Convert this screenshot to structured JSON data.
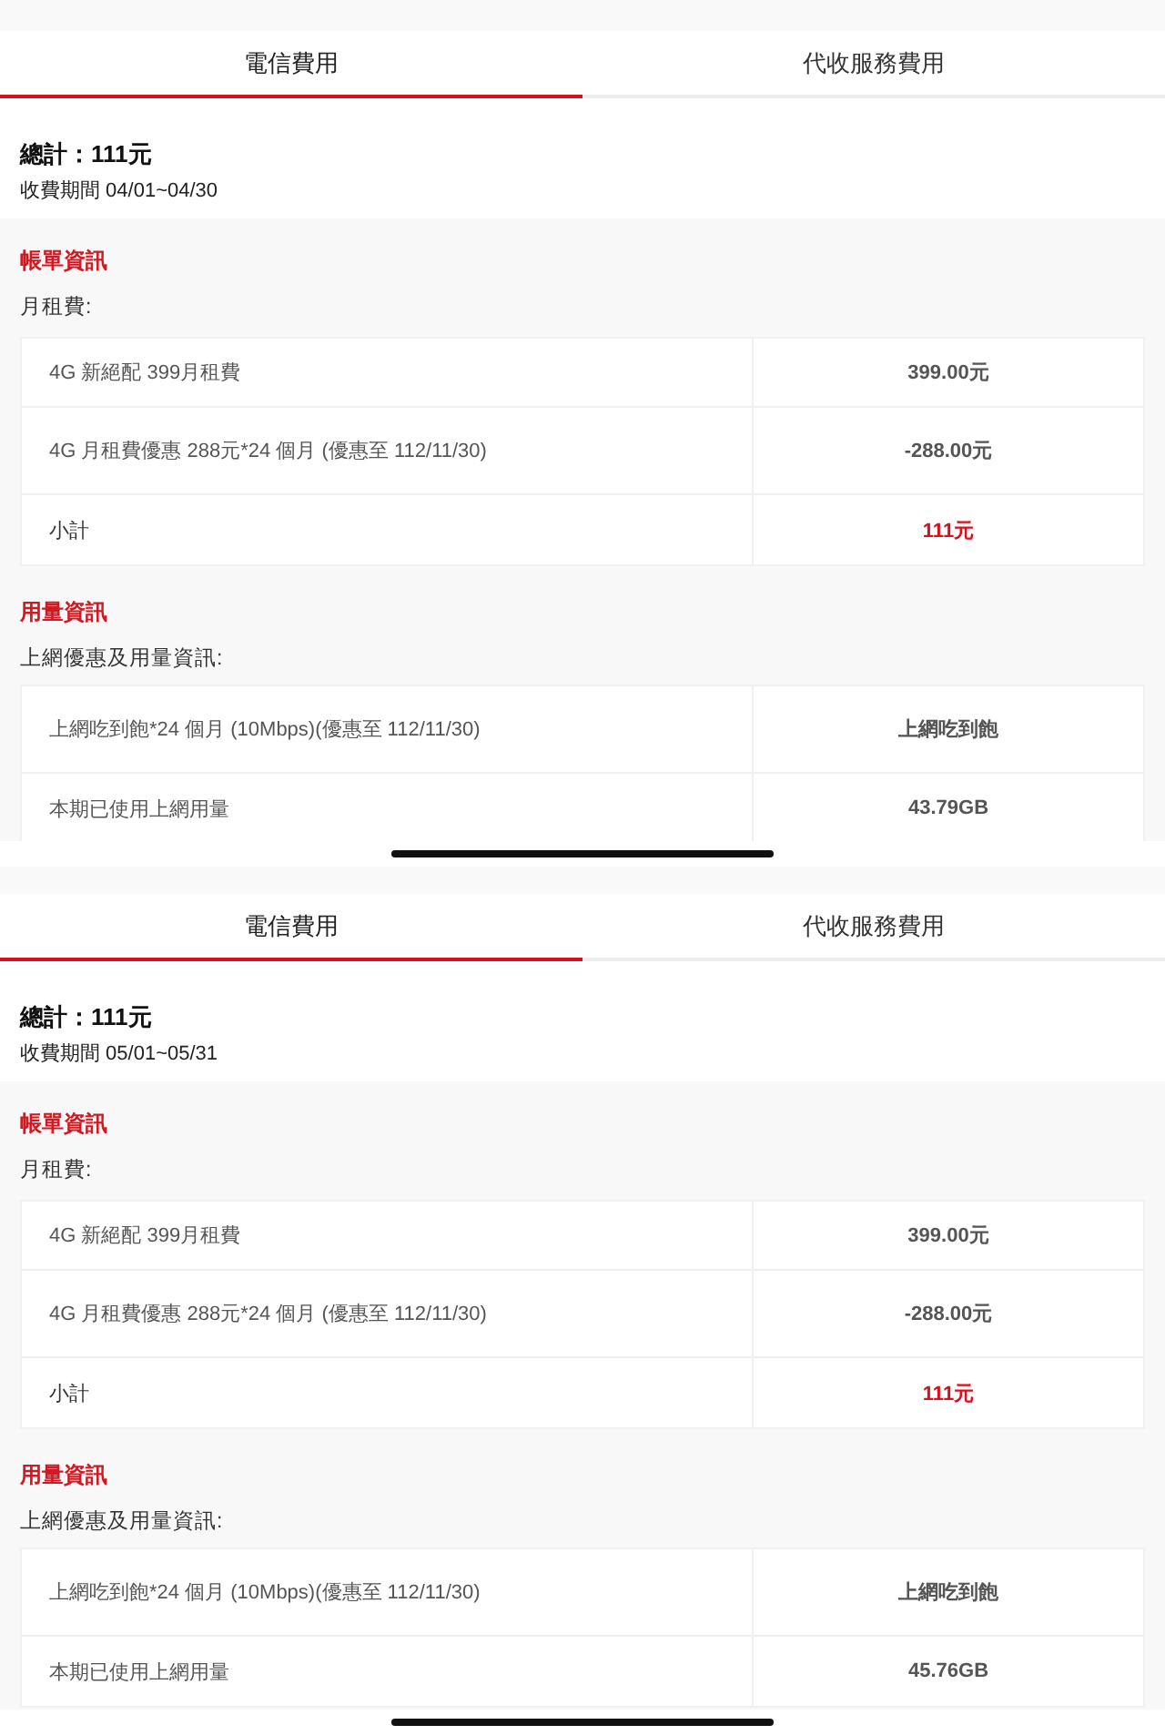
{
  "screens": [
    {
      "tabs": [
        {
          "label": "電信費用",
          "selected": true
        },
        {
          "label": "代收服務費用",
          "selected": false
        }
      ],
      "total": "總計：111元",
      "period": "收費期間 04/01~04/30",
      "sections": [
        {
          "title": "帳單資訊",
          "subtitle": "月租費:",
          "rows": [
            {
              "kind": "item",
              "label": "4G 新絕配 399月租費",
              "value": "399.00元"
            },
            {
              "kind": "item",
              "label": "4G 月租費優惠 288元*24 個月 (優惠至 112/11/30)",
              "value": "-288.00元"
            },
            {
              "kind": "subtotal",
              "label": "小計",
              "value": "111元"
            }
          ]
        },
        {
          "title": "用量資訊",
          "subtitle": "上網優惠及用量資訊:",
          "rows": [
            {
              "kind": "item",
              "label": "上網吃到飽*24 個月 (10Mbps)(優惠至 112/11/30)",
              "value": "上網吃到飽"
            },
            {
              "kind": "item",
              "label": "本期已使用上網用量",
              "value": "43.79GB"
            }
          ]
        }
      ]
    },
    {
      "tabs": [
        {
          "label": "電信費用",
          "selected": true
        },
        {
          "label": "代收服務費用",
          "selected": false
        }
      ],
      "total": "總計：111元",
      "period": "收費期間 05/01~05/31",
      "sections": [
        {
          "title": "帳單資訊",
          "subtitle": "月租費:",
          "rows": [
            {
              "kind": "item",
              "label": "4G 新絕配 399月租費",
              "value": "399.00元"
            },
            {
              "kind": "item",
              "label": "4G 月租費優惠 288元*24 個月 (優惠至 112/11/30)",
              "value": "-288.00元"
            },
            {
              "kind": "subtotal",
              "label": "小計",
              "value": "111元"
            }
          ]
        },
        {
          "title": "用量資訊",
          "subtitle": "上網優惠及用量資訊:",
          "rows": [
            {
              "kind": "item",
              "label": "上網吃到飽*24 個月 (10Mbps)(優惠至 112/11/30)",
              "value": "上網吃到飽"
            },
            {
              "kind": "item",
              "label": "本期已使用上網用量",
              "value": "45.76GB"
            }
          ]
        }
      ]
    }
  ]
}
